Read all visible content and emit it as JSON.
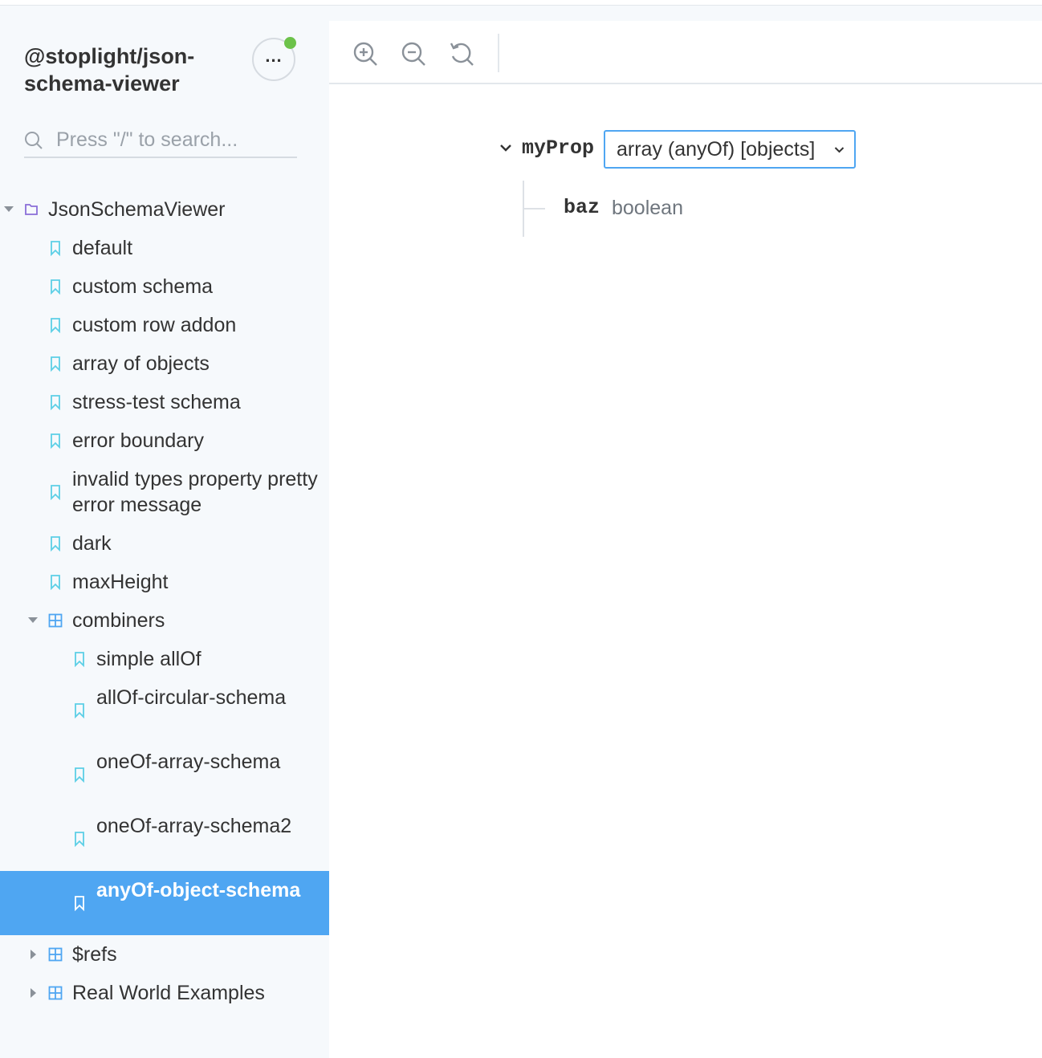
{
  "sidebar": {
    "brand": "@stoplight/json-schema-viewer",
    "search_placeholder": "Press \"/\" to search...",
    "tree": [
      {
        "label": "JsonSchemaViewer",
        "kind": "folder",
        "depth": 0,
        "expanded": true
      },
      {
        "label": "default",
        "kind": "story",
        "depth": 1
      },
      {
        "label": "custom schema",
        "kind": "story",
        "depth": 1
      },
      {
        "label": "custom row addon",
        "kind": "story",
        "depth": 1
      },
      {
        "label": "array of objects",
        "kind": "story",
        "depth": 1
      },
      {
        "label": "stress-test schema",
        "kind": "story",
        "depth": 1
      },
      {
        "label": "error boundary",
        "kind": "story",
        "depth": 1
      },
      {
        "label": "invalid types property pretty error message",
        "kind": "story",
        "depth": 1
      },
      {
        "label": "dark",
        "kind": "story",
        "depth": 1
      },
      {
        "label": "maxHeight",
        "kind": "story",
        "depth": 1
      },
      {
        "label": "combiners",
        "kind": "component",
        "depth": 1,
        "expanded": true
      },
      {
        "label": "simple allOf",
        "kind": "story",
        "depth": 2
      },
      {
        "label": "allOf-circular-schema",
        "kind": "story",
        "depth": 2
      },
      {
        "label": "oneOf-array-schema",
        "kind": "story",
        "depth": 2
      },
      {
        "label": "oneOf-array-schema2",
        "kind": "story",
        "depth": 2
      },
      {
        "label": "anyOf-object-schema",
        "kind": "story",
        "depth": 2,
        "active": true
      },
      {
        "label": "$refs",
        "kind": "component",
        "depth": 1,
        "expanded": false
      },
      {
        "label": "Real World Examples",
        "kind": "component",
        "depth": 1,
        "expanded": false
      }
    ]
  },
  "toolbar": {
    "zoom_in": "zoom-in-icon",
    "zoom_out": "zoom-out-icon",
    "reset": "reset-zoom-icon"
  },
  "schema": {
    "prop_name": "myProp",
    "type_value": "array (anyOf) [objects]",
    "child": {
      "name": "baz",
      "type": "boolean"
    }
  },
  "colors": {
    "accent": "#4fa6f2",
    "status": "#6cc24a",
    "story_icon": "#5ccfe6",
    "folder_icon": "#8a6ed8",
    "component_icon": "#4fa6f2"
  }
}
